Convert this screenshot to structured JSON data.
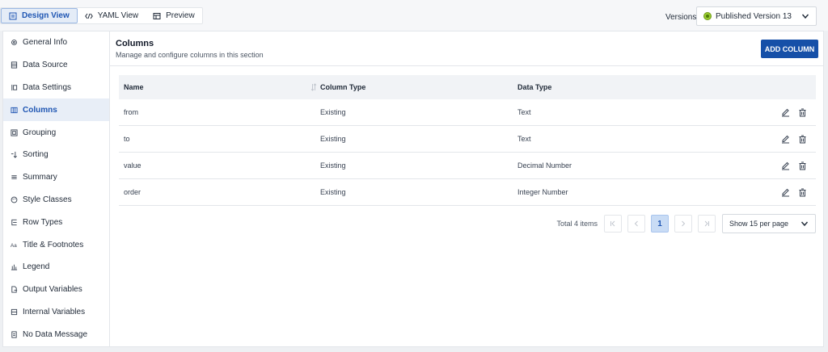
{
  "tabs": [
    {
      "label": "Design View",
      "icon": "design-view-icon",
      "active": true
    },
    {
      "label": "YAML View",
      "icon": "code-icon",
      "active": false
    },
    {
      "label": "Preview",
      "icon": "preview-icon",
      "active": false
    }
  ],
  "versions": {
    "label": "Versions",
    "selected": "Published Version 13",
    "status_color": "#9acd32"
  },
  "sidebar": {
    "items": [
      {
        "label": "General Info",
        "icon": "gear-icon"
      },
      {
        "label": "Data Source",
        "icon": "database-icon"
      },
      {
        "label": "Data Settings",
        "icon": "data-settings-icon"
      },
      {
        "label": "Columns",
        "icon": "columns-icon",
        "active": true
      },
      {
        "label": "Grouping",
        "icon": "grouping-icon"
      },
      {
        "label": "Sorting",
        "icon": "sorting-icon"
      },
      {
        "label": "Summary",
        "icon": "summary-icon"
      },
      {
        "label": "Style Classes",
        "icon": "palette-icon"
      },
      {
        "label": "Row Types",
        "icon": "row-types-icon"
      },
      {
        "label": "Title & Footnotes",
        "icon": "text-icon"
      },
      {
        "label": "Legend",
        "icon": "legend-icon"
      },
      {
        "label": "Output Variables",
        "icon": "output-variables-icon"
      },
      {
        "label": "Internal Variables",
        "icon": "internal-variables-icon"
      },
      {
        "label": "No Data Message",
        "icon": "message-icon"
      }
    ]
  },
  "section": {
    "title": "Columns",
    "subtitle": "Manage and configure columns in this section",
    "add_button": "ADD COLUMN"
  },
  "table": {
    "headers": [
      "Name",
      "Column Type",
      "Data Type"
    ],
    "rows": [
      {
        "name": "from",
        "column_type": "Existing",
        "data_type": "Text"
      },
      {
        "name": "to",
        "column_type": "Existing",
        "data_type": "Text"
      },
      {
        "name": "value",
        "column_type": "Existing",
        "data_type": "Decimal Number"
      },
      {
        "name": "order",
        "column_type": "Existing",
        "data_type": "Integer Number"
      }
    ]
  },
  "pagination": {
    "total": "Total 4 items",
    "current_page": "1",
    "per_page": "Show 15 per page"
  },
  "colors": {
    "accent": "#1650a8",
    "active_bg": "#e8eef7",
    "header_bg": "#f1f3f6"
  }
}
